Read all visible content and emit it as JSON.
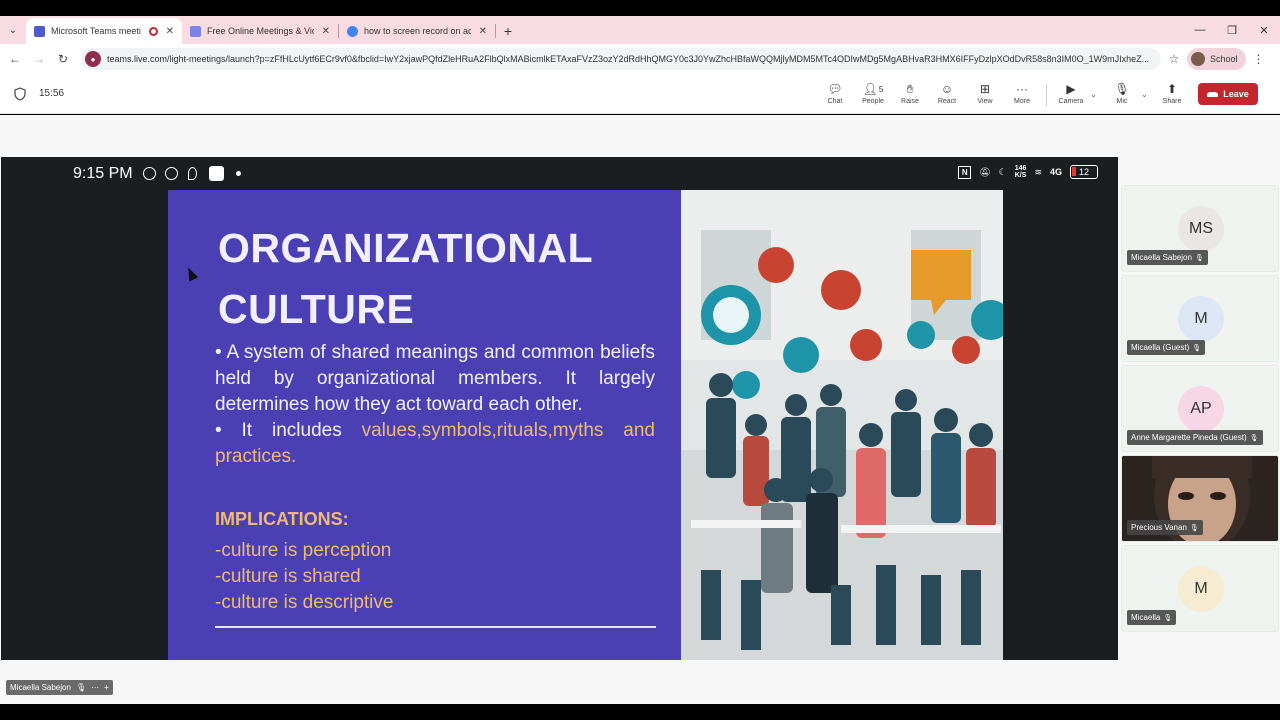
{
  "browser": {
    "tabs": [
      {
        "title": "Microsoft Teams meeting | ",
        "active": true,
        "fav": "#5059c9"
      },
      {
        "title": "Free Online Meetings & Video C",
        "active": false,
        "fav": "#7b83eb"
      },
      {
        "title": "how to screen record on acer c",
        "active": false,
        "fav": "#4285f4"
      }
    ],
    "url": "teams.live.com/light-meetings/launch?p=zFfHLcUytf6ECr9vf0&fbclid=IwY2xjawPQfdZleHRuA2FlbQlxMABicmlkETAxaFVzZ3ozY2dRdHhQMGY0c3J0YwZhcHBfaWQQMjlyMDM5MTc4ODIwMDg5MgABHvaR3HMX6IFFyDzlpXOdDvR58s8n3IM0O_1W9mJIxheZ...",
    "profile_label": "School"
  },
  "teams": {
    "timer": "15:56",
    "people_count": "5",
    "buttons": {
      "chat": "Chat",
      "people": "People",
      "raise": "Raise",
      "react": "React",
      "view": "View",
      "more": "More",
      "camera": "Camera",
      "mic": "Mic",
      "share": "Share",
      "leave": "Leave"
    }
  },
  "phone_status": {
    "time": "9:15 PM",
    "speed_top": "146",
    "speed_bottom": "K/S",
    "network": "4G",
    "battery": "12"
  },
  "slide": {
    "title_line1": "ORGANIZATIONAL",
    "title_line2": "CULTURE",
    "bullet1": "• A system of shared meanings and common beliefs held by organizational members. It largely determines how they act toward each other.",
    "bullet2_prefix": "• It includes ",
    "bullet2_highlight": "values,symbols,rituals,myths and practices.",
    "implications_heading": "IMPLICATIONS:",
    "implications": [
      "-culture is perception",
      "-culture is shared",
      "-culture is descriptive"
    ]
  },
  "participants": [
    {
      "initials": "MS",
      "name": "Micaella Sabejon",
      "color": "#e9e6e4"
    },
    {
      "initials": "M",
      "name": "Micaella (Guest)",
      "color": "#dde6f4"
    },
    {
      "initials": "AP",
      "name": "Anne Margarette Pineda (Guest)",
      "color": "#f7d6e6"
    },
    {
      "initials": "",
      "name": "Precious Vanan",
      "color": "#2a2320"
    },
    {
      "initials": "M",
      "name": "Micaella",
      "color": "#f6ecd2"
    }
  ],
  "presenter_label": "Micaella Sabejon"
}
